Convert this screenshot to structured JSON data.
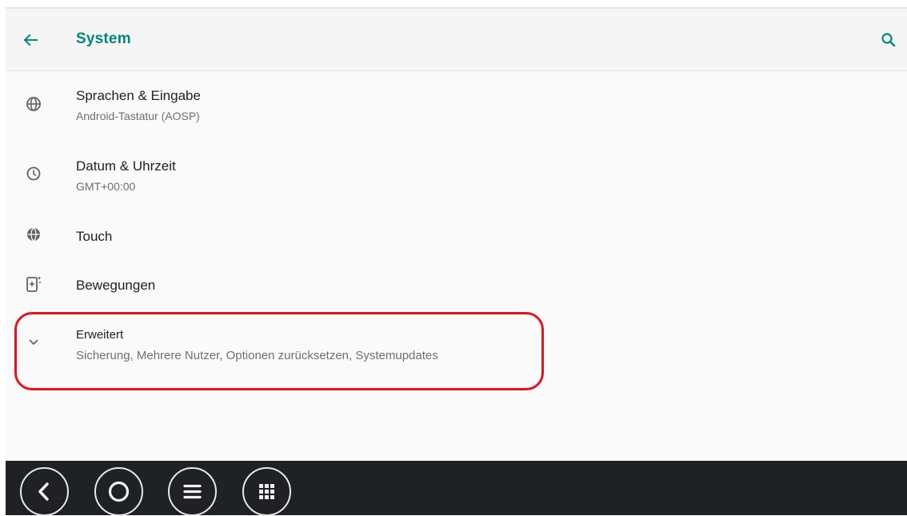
{
  "appbar": {
    "title": "System",
    "back_icon": "arrow-left-icon",
    "search_icon": "search-icon",
    "accent_color": "#00897b"
  },
  "settings": [
    {
      "icon": "globe-icon",
      "label": "Sprachen & Eingabe",
      "sub": "Android-Tastatur (AOSP)"
    },
    {
      "icon": "clock-icon",
      "label": "Datum & Uhrzeit",
      "sub": "GMT+00:00"
    },
    {
      "icon": "touch-globe-icon",
      "label": "Touch"
    },
    {
      "icon": "phone-sparkle-icon",
      "label": "Bewegungen"
    },
    {
      "icon": "chevron-down-icon",
      "label": "Erweitert",
      "sub": "Sicherung, Mehrere Nutzer, Optionen zurücksetzen, Systemupdates"
    }
  ],
  "highlight_color": "#e4141e",
  "navbar": {
    "buttons": [
      "back-icon",
      "home-icon",
      "menu-icon",
      "apps-grid-icon"
    ]
  }
}
